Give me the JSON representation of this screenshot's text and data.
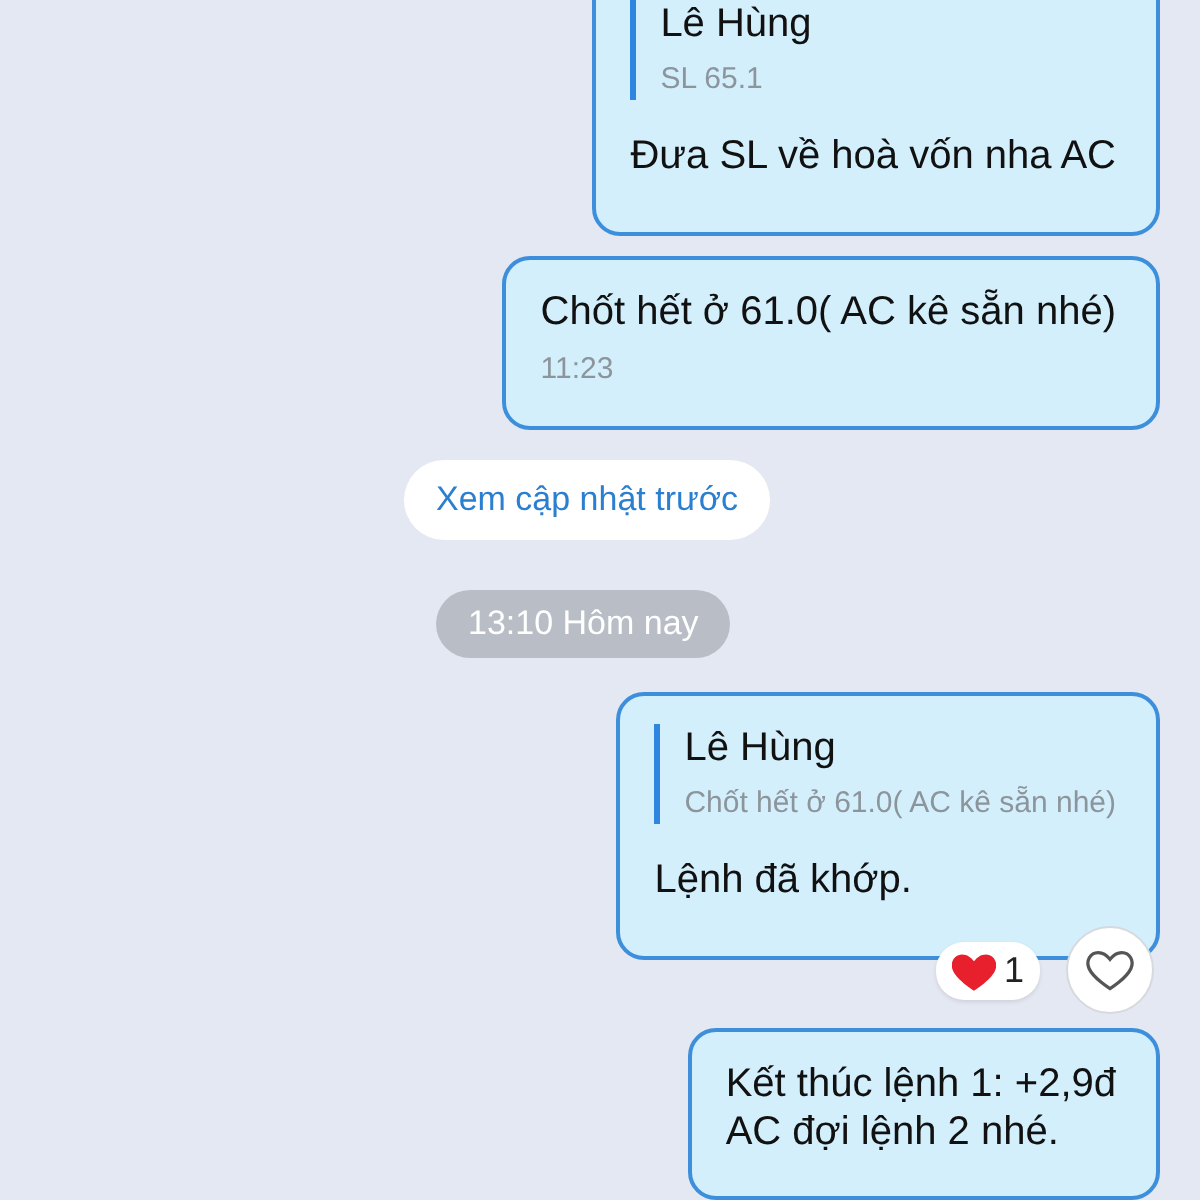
{
  "messages": [
    {
      "kind": "reply",
      "quote_author": "Lê Hùng",
      "quote_text": "SL 65.1",
      "text": "Đưa SL về hoà vốn nha AC"
    },
    {
      "kind": "text",
      "text": "Chốt hết ở 61.0( AC kê sẵn nhé)",
      "time": "11:23"
    },
    {
      "kind": "link",
      "text": "Xem cập nhật trước"
    },
    {
      "kind": "date",
      "text": "13:10 Hôm nay"
    },
    {
      "kind": "reply",
      "quote_author": "Lê Hùng",
      "quote_text": "Chốt hết ở 61.0( AC kê sẵn nhé)",
      "text": "Lệnh đã khớp.",
      "reaction_count": "1"
    },
    {
      "kind": "text",
      "text": "Kết thúc lệnh 1: +2,9đ\nAC đợi lệnh 2 nhé."
    }
  ]
}
